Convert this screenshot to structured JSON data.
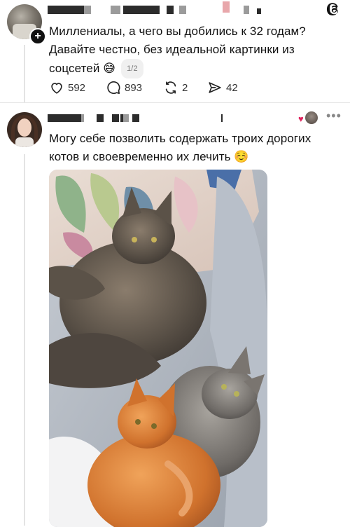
{
  "post1": {
    "text_line1": "Миллениалы, а чего вы добились к 32 годам?",
    "text_line2": "Давайте честно, без идеальной картинки из",
    "text_line3": "соцсетей",
    "emoji": "😅",
    "page_counter": "1/2",
    "likes": "592",
    "comments": "893",
    "reposts": "2",
    "shares": "42"
  },
  "post2": {
    "text_line1": "Могу себе позволить содержать троих дорогих",
    "text_line2": "котов и своевременно их лечить",
    "emoji": "☺️"
  },
  "icons": {
    "app_logo": "threads-logo-icon",
    "follow": "plus-icon",
    "like": "heart-icon",
    "comment": "comment-bubble-icon",
    "repost": "repost-icon",
    "share": "share-icon",
    "more": "more-dots-icon"
  },
  "colors": {
    "heart_badge": "#e0245e",
    "thread_line": "#e3e3e3"
  }
}
